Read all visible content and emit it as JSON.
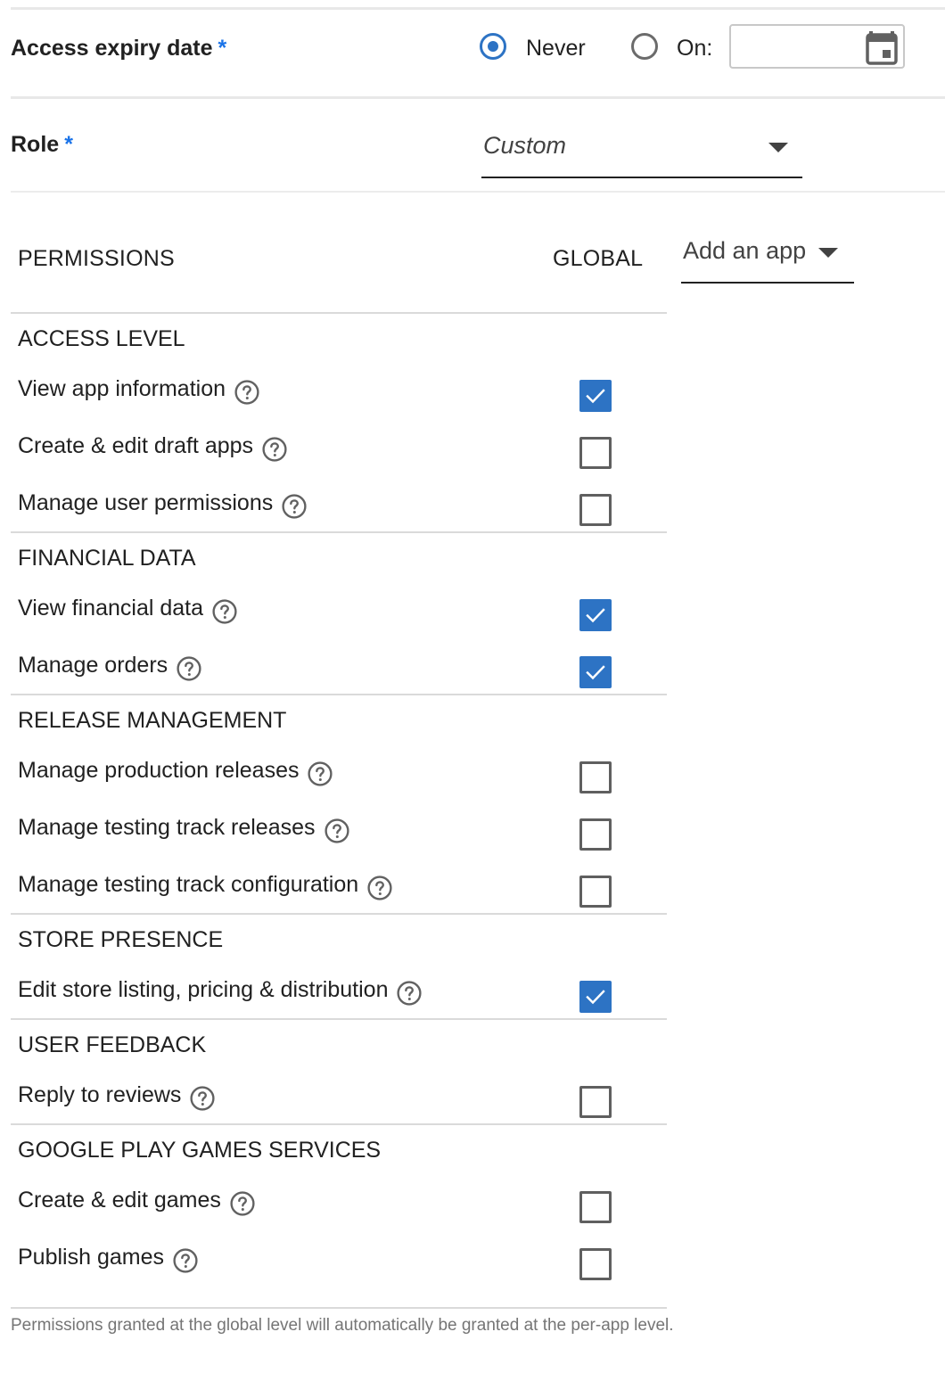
{
  "expiry": {
    "label": "Access expiry date",
    "required_mark": "*",
    "options": [
      {
        "label": "Never",
        "selected": true
      },
      {
        "label": "On:",
        "selected": false
      }
    ],
    "date_value": "",
    "icon": "calendar-icon"
  },
  "role": {
    "label": "Role",
    "required_mark": "*",
    "selected": "Custom"
  },
  "permissions": {
    "header": "PERMISSIONS",
    "global_header": "GLOBAL",
    "add_app": "Add an app",
    "sections": [
      {
        "title": "ACCESS LEVEL",
        "items": [
          {
            "label": "View app information",
            "checked": true
          },
          {
            "label": "Create & edit draft apps",
            "checked": false
          },
          {
            "label": "Manage user permissions",
            "checked": false
          }
        ]
      },
      {
        "title": "FINANCIAL DATA",
        "items": [
          {
            "label": "View financial data",
            "checked": true
          },
          {
            "label": "Manage orders",
            "checked": true
          }
        ]
      },
      {
        "title": "RELEASE MANAGEMENT",
        "items": [
          {
            "label": "Manage production releases",
            "checked": false
          },
          {
            "label": "Manage testing track releases",
            "checked": false
          },
          {
            "label": "Manage testing track configuration",
            "checked": false
          }
        ]
      },
      {
        "title": "STORE PRESENCE",
        "items": [
          {
            "label": "Edit store listing, pricing & distribution",
            "checked": true
          }
        ]
      },
      {
        "title": "USER FEEDBACK",
        "items": [
          {
            "label": "Reply to reviews",
            "checked": false
          }
        ]
      },
      {
        "title": "GOOGLE PLAY GAMES SERVICES",
        "items": [
          {
            "label": "Create & edit games",
            "checked": false
          },
          {
            "label": "Publish games",
            "checked": false
          }
        ]
      }
    ]
  },
  "footnote": "Permissions granted at the global level will automatically be granted at the per-app level.",
  "colors": {
    "accent": "#2d73c4",
    "required": "#1a73e8"
  }
}
